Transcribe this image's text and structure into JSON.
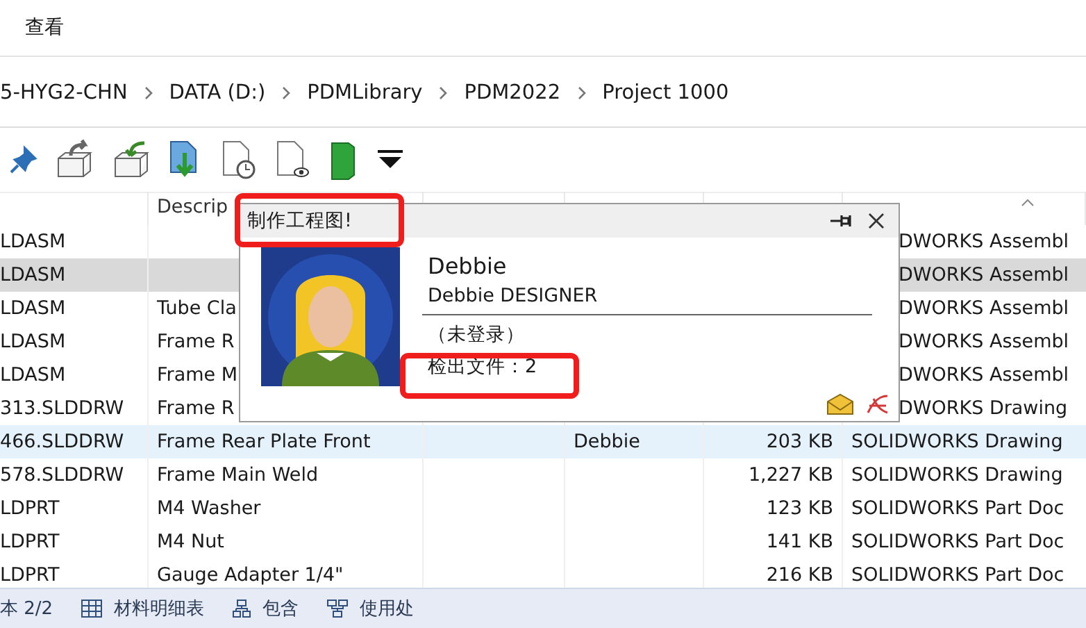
{
  "menu": {
    "items": [
      "查看"
    ]
  },
  "breadcrumb": [
    "5-HYG2-CHN",
    "DATA (D:)",
    "PDMLibrary",
    "PDM2022",
    "Project 1000"
  ],
  "table": {
    "columns": [
      "",
      "Descrip",
      "",
      "",
      "",
      ""
    ],
    "rows": [
      {
        "cells": [
          "LDASM",
          "",
          "",
          "",
          "",
          "DWORKS Assembl"
        ],
        "selected": false,
        "hovered": false
      },
      {
        "cells": [
          "LDASM",
          "",
          "",
          "",
          "",
          "DWORKS Assembl"
        ],
        "selected": true,
        "hovered": false
      },
      {
        "cells": [
          "LDASM",
          "Tube Cla",
          "",
          "",
          "",
          "DWORKS Assembl"
        ],
        "selected": false,
        "hovered": false
      },
      {
        "cells": [
          "LDASM",
          "Frame R",
          "",
          "",
          "",
          "DWORKS Assembl"
        ],
        "selected": false,
        "hovered": false
      },
      {
        "cells": [
          "LDASM",
          "Frame M",
          "",
          "",
          "",
          "DWORKS Assembl"
        ],
        "selected": false,
        "hovered": false
      },
      {
        "cells": [
          "313.SLDDRW",
          "Frame R",
          "",
          "",
          "",
          "DWORKS Drawing"
        ],
        "selected": false,
        "hovered": false
      },
      {
        "cells": [
          "466.SLDDRW",
          "Frame Rear Plate Front",
          "",
          "Debbie",
          "203 KB",
          "SOLIDWORKS Drawing"
        ],
        "selected": false,
        "hovered": true
      },
      {
        "cells": [
          "578.SLDDRW",
          "Frame Main Weld",
          "",
          "",
          "1,227 KB",
          "SOLIDWORKS Drawing"
        ],
        "selected": false,
        "hovered": false
      },
      {
        "cells": [
          "LDPRT",
          "M4 Washer",
          "",
          "",
          "123 KB",
          "SOLIDWORKS Part Doc"
        ],
        "selected": false,
        "hovered": false
      },
      {
        "cells": [
          "LDPRT",
          "M4 Nut",
          "",
          "",
          "141 KB",
          "SOLIDWORKS Part Doc"
        ],
        "selected": false,
        "hovered": false
      },
      {
        "cells": [
          "LDPRT",
          "Gauge Adapter 1/4\"",
          "",
          "",
          "216 KB",
          "SOLIDWORKS Part Doc"
        ],
        "selected": false,
        "hovered": false
      }
    ]
  },
  "popup": {
    "title": "制作工程图!",
    "name": "Debbie",
    "full_name": "Debbie DESIGNER",
    "status": "（未登录）",
    "checked_out": "检出文件：2"
  },
  "status_bar": {
    "version": "本 2/2",
    "tabs": [
      "材料明细表",
      "包含",
      "使用处"
    ]
  }
}
